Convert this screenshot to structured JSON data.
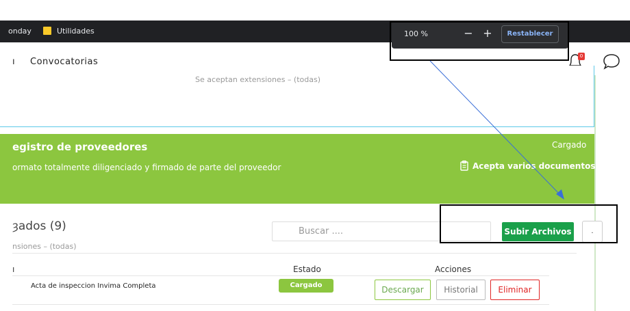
{
  "bookmarks": {
    "items": [
      {
        "label": "onday"
      },
      {
        "label": "Utilidades"
      }
    ]
  },
  "zoom": {
    "level": "100 %",
    "minus": "−",
    "plus": "+",
    "reset_label": "Restablecer"
  },
  "nav": {
    "prev_partial": "ı",
    "convocatorias": "Convocatorias",
    "notification_count": "0"
  },
  "card": {
    "extensions_top": "Se aceptan extensiones – (todas)"
  },
  "requirement": {
    "title": "egistro de proveedores",
    "description": "ormato totalmente diligenciado y firmado de parte del proveedor",
    "status": "Cargado",
    "multi_docs": "Acepta varios documentos"
  },
  "files": {
    "heading": "ȝados (9)",
    "extensions_sub": "nsiones – (todas)",
    "search_placeholder": "Buscar ....",
    "upload_label": "Subir Archivos",
    "more_label": ".",
    "columns": {
      "name_partial": "ı",
      "estado": "Estado",
      "acciones": "Acciones"
    },
    "rows": [
      {
        "name": "Acta de inspeccion Invima Completa",
        "status": "Cargado",
        "download": "Descargar",
        "history": "Historial",
        "delete": "Eliminar"
      }
    ]
  },
  "colors": {
    "green_panel": "#8cc63f",
    "primary_button": "#1aa04a",
    "danger": "#e02424",
    "annotation_arrow": "#3a6fd8"
  }
}
